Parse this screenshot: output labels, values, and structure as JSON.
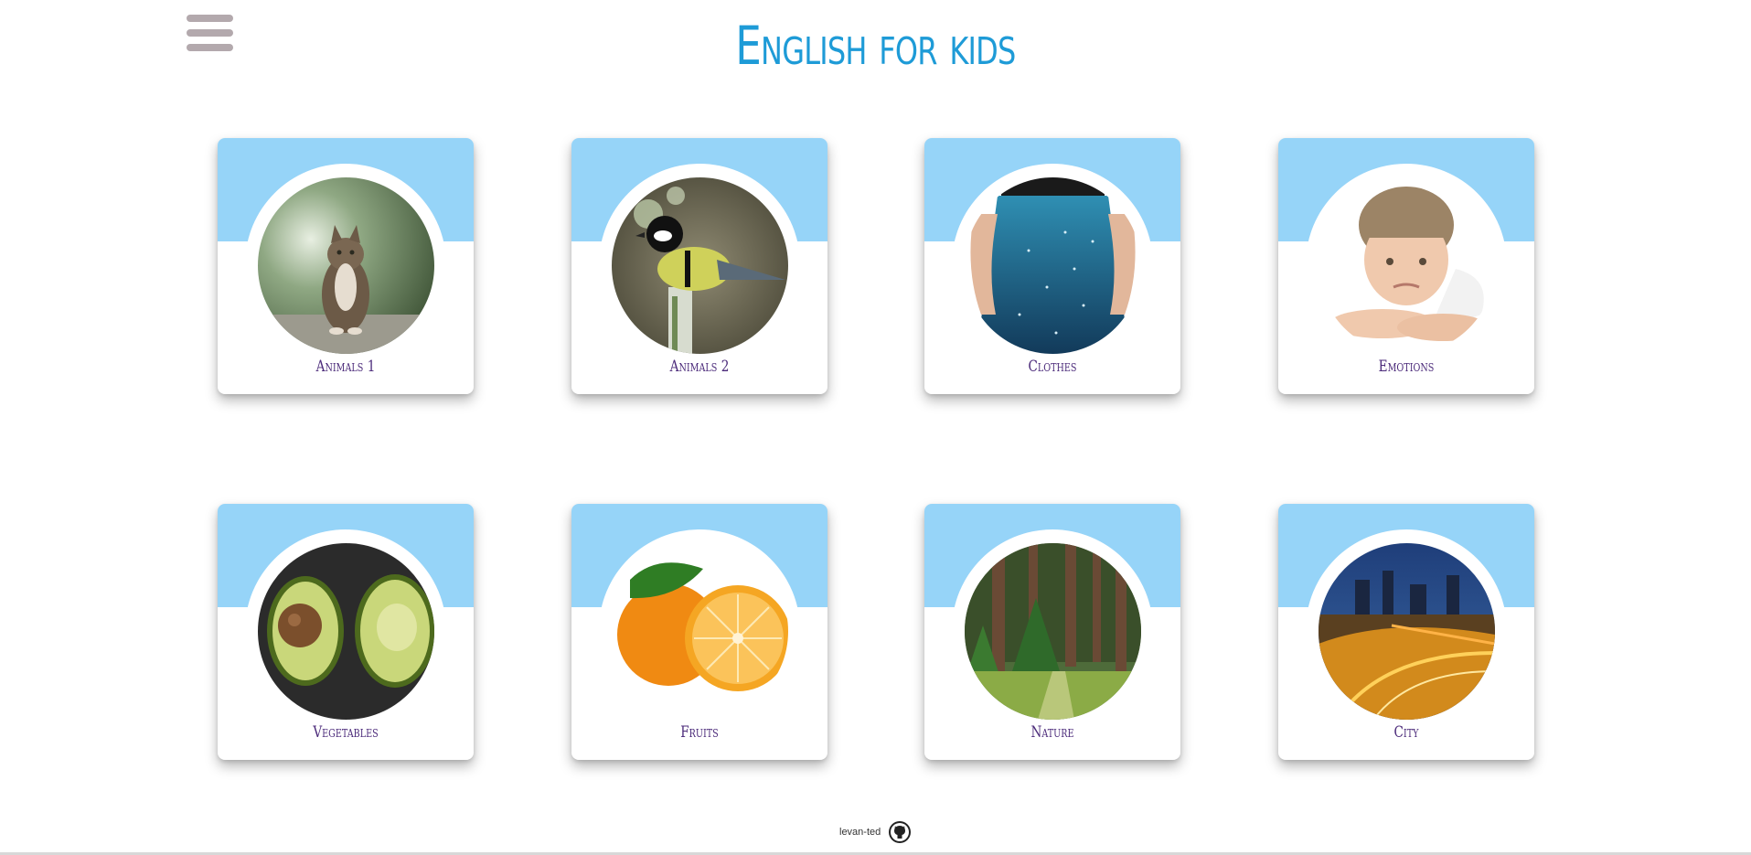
{
  "header": {
    "title": "English for kids",
    "menu_icon": "hamburger-menu-icon"
  },
  "categories": [
    {
      "label": "Animals 1",
      "image": "cat-photo"
    },
    {
      "label": "Animals 2",
      "image": "bird-photo"
    },
    {
      "label": "Clothes",
      "image": "skirt-photo"
    },
    {
      "label": "Emotions",
      "image": "sad-boy-photo"
    },
    {
      "label": "Vegetables",
      "image": "avocado-photo"
    },
    {
      "label": "Fruits",
      "image": "orange-photo"
    },
    {
      "label": "Nature",
      "image": "forest-photo"
    },
    {
      "label": "City",
      "image": "city-night-photo"
    }
  ],
  "footer": {
    "author": "levan-ted",
    "icon": "github-icon"
  },
  "colors": {
    "title": "#1e9bd7",
    "card_top": "#96d4f8",
    "label": "#4b2a7a",
    "menu": "#b3a9ad"
  }
}
